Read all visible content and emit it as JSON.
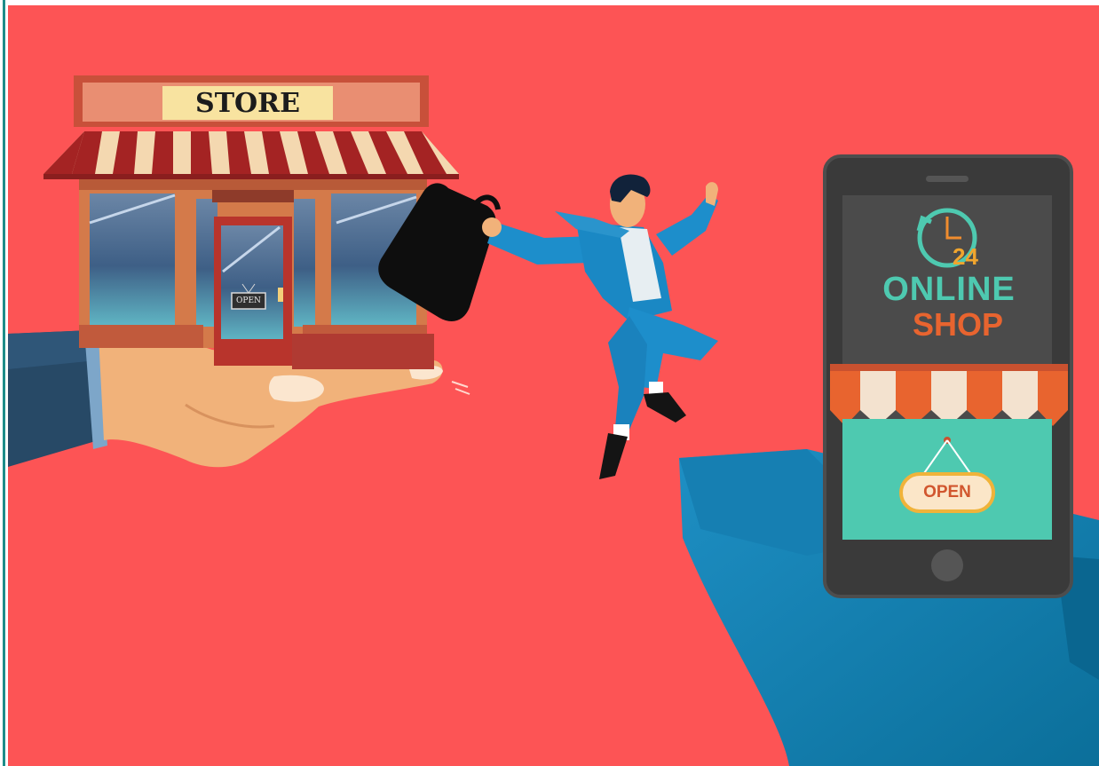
{
  "store": {
    "sign_text": "STORE",
    "door_sign_text": "OPEN"
  },
  "phone": {
    "hours_number": "24",
    "title_line1": "ONLINE",
    "title_line2": "SHOP",
    "open_sign_text": "OPEN"
  },
  "colors": {
    "background": "#fd5455",
    "teal_accent": "#4ec9b0",
    "orange_accent": "#e8642f",
    "phone_body": "#3a3a3a",
    "suit_blue": "#1d8ecb"
  },
  "icons": [
    "clock-icon",
    "briefcase-icon",
    "hand-illustration",
    "smartphone-illustration",
    "storefront-illustration",
    "businessman-illustration"
  ]
}
